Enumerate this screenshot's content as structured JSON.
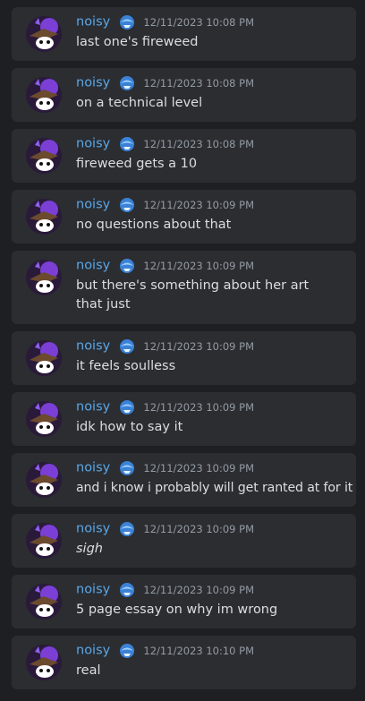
{
  "messages": [
    {
      "author": "noisy",
      "timestamp": "12/11/2023 10:08 PM",
      "text": "last one's fireweed",
      "italic": false
    },
    {
      "author": "noisy",
      "timestamp": "12/11/2023 10:08 PM",
      "text": "on a technical level",
      "italic": false
    },
    {
      "author": "noisy",
      "timestamp": "12/11/2023 10:08 PM",
      "text": "fireweed gets a 10",
      "italic": false
    },
    {
      "author": "noisy",
      "timestamp": "12/11/2023 10:09 PM",
      "text": "no questions about that",
      "italic": false
    },
    {
      "author": "noisy",
      "timestamp": "12/11/2023 10:09 PM",
      "text": "but there's something about her art that just",
      "italic": false
    },
    {
      "author": "noisy",
      "timestamp": "12/11/2023 10:09 PM",
      "text": "it feels soulless",
      "italic": false
    },
    {
      "author": "noisy",
      "timestamp": "12/11/2023 10:09 PM",
      "text": "idk how to say it",
      "italic": false
    },
    {
      "author": "noisy",
      "timestamp": "12/11/2023 10:09 PM",
      "text": "and i know i probably will get ranted at for it",
      "italic": false
    },
    {
      "author": "noisy",
      "timestamp": "12/11/2023 10:09 PM",
      "text": "sigh",
      "italic": true
    },
    {
      "author": "noisy",
      "timestamp": "12/11/2023 10:09 PM",
      "text": "5 page essay on why im wrong",
      "italic": false
    },
    {
      "author": "noisy",
      "timestamp": "12/11/2023 10:10 PM",
      "text": "real",
      "italic": false
    }
  ],
  "icons": {
    "avatar": "user-avatar",
    "badge": "role-badge-icon"
  },
  "colors": {
    "background": "#1e1f22",
    "message_background": "#2b2d31",
    "username": "#5aa6e6",
    "timestamp": "#949ba4",
    "text": "#dbdee1"
  }
}
